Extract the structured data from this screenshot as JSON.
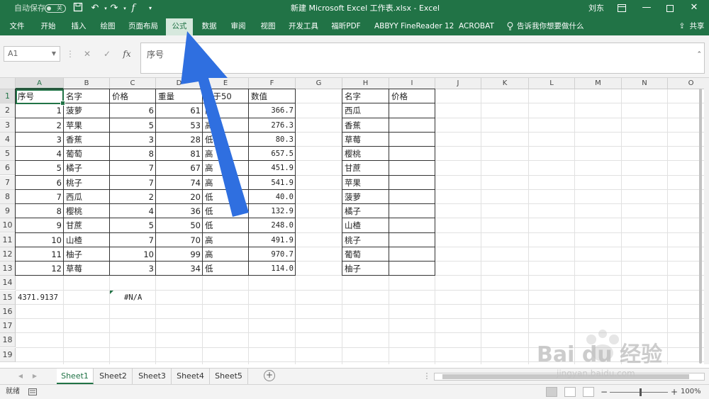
{
  "titlebar": {
    "autosave_label": "自动保存",
    "autosave_state": "关",
    "title": "新建 Microsoft Excel 工作表.xlsx  -  Excel",
    "user": "刘东",
    "icons": [
      "save-icon",
      "undo-icon",
      "redo-icon",
      "fx-icon",
      "customize-qa-icon",
      "ribbon-display-icon",
      "minimize-icon",
      "maximize-icon",
      "close-icon"
    ]
  },
  "ribbon": {
    "tabs": [
      "文件",
      "开始",
      "插入",
      "绘图",
      "页面布局",
      "公式",
      "数据",
      "审阅",
      "视图",
      "开发工具",
      "福昕PDF",
      "ABBYY FineReader 12",
      "ACROBAT"
    ],
    "active_tab": "公式",
    "tell_me": "告诉我你想要做什么",
    "share": "共享"
  },
  "formula_bar": {
    "name_box": "A1",
    "fx_label": "fx",
    "content": "序号"
  },
  "columns": [
    "A",
    "B",
    "C",
    "D",
    "E",
    "F",
    "G",
    "H",
    "I",
    "J",
    "K",
    "L",
    "M",
    "N",
    "O"
  ],
  "rows": [
    "1",
    "2",
    "3",
    "4",
    "5",
    "6",
    "7",
    "8",
    "9",
    "10",
    "11",
    "12",
    "13",
    "14",
    "15",
    "16",
    "17",
    "18",
    "19"
  ],
  "table1": {
    "headers": [
      "序号",
      "名字",
      "价格",
      "重量",
      "大于50",
      "数值"
    ],
    "rows": [
      [
        "1",
        "菠萝",
        "6",
        "61",
        "高",
        "366.7"
      ],
      [
        "2",
        "苹果",
        "5",
        "53",
        "高",
        "276.3"
      ],
      [
        "3",
        "香蕉",
        "3",
        "28",
        "低",
        "80.3"
      ],
      [
        "4",
        "葡萄",
        "8",
        "81",
        "高",
        "657.5"
      ],
      [
        "5",
        "橘子",
        "7",
        "67",
        "高",
        "451.9"
      ],
      [
        "6",
        "桃子",
        "7",
        "74",
        "高",
        "541.9"
      ],
      [
        "7",
        "西瓜",
        "2",
        "20",
        "低",
        "40.0"
      ],
      [
        "8",
        "樱桃",
        "4",
        "36",
        "低",
        "132.9"
      ],
      [
        "9",
        "甘蔗",
        "5",
        "50",
        "低",
        "248.0"
      ],
      [
        "10",
        "山楂",
        "7",
        "70",
        "高",
        "491.9"
      ],
      [
        "11",
        "柚子",
        "10",
        "99",
        "高",
        "970.7"
      ],
      [
        "12",
        "草莓",
        "3",
        "34",
        "低",
        "114.0"
      ]
    ]
  },
  "table2": {
    "headers": [
      "名字",
      "价格"
    ],
    "names": [
      "西瓜",
      "香蕉",
      "草莓",
      "樱桃",
      "甘蔗",
      "苹果",
      "菠萝",
      "橘子",
      "山楂",
      "桃子",
      "葡萄",
      "柚子"
    ]
  },
  "row15": {
    "a": "4371.9137",
    "c": "#N/A"
  },
  "sheets": [
    "Sheet1",
    "Sheet2",
    "Sheet3",
    "Sheet4",
    "Sheet5"
  ],
  "active_sheet": "Sheet1",
  "status": {
    "ready": "就绪",
    "zoom": "100%"
  },
  "watermark": {
    "text": "Bai du 经验",
    "url": "jingyan.baidu.com"
  },
  "annotation": {
    "arrow_color": "#2f6fe0",
    "points_to": "公式"
  },
  "colors": {
    "excel_green": "#217346",
    "border": "#333333"
  }
}
